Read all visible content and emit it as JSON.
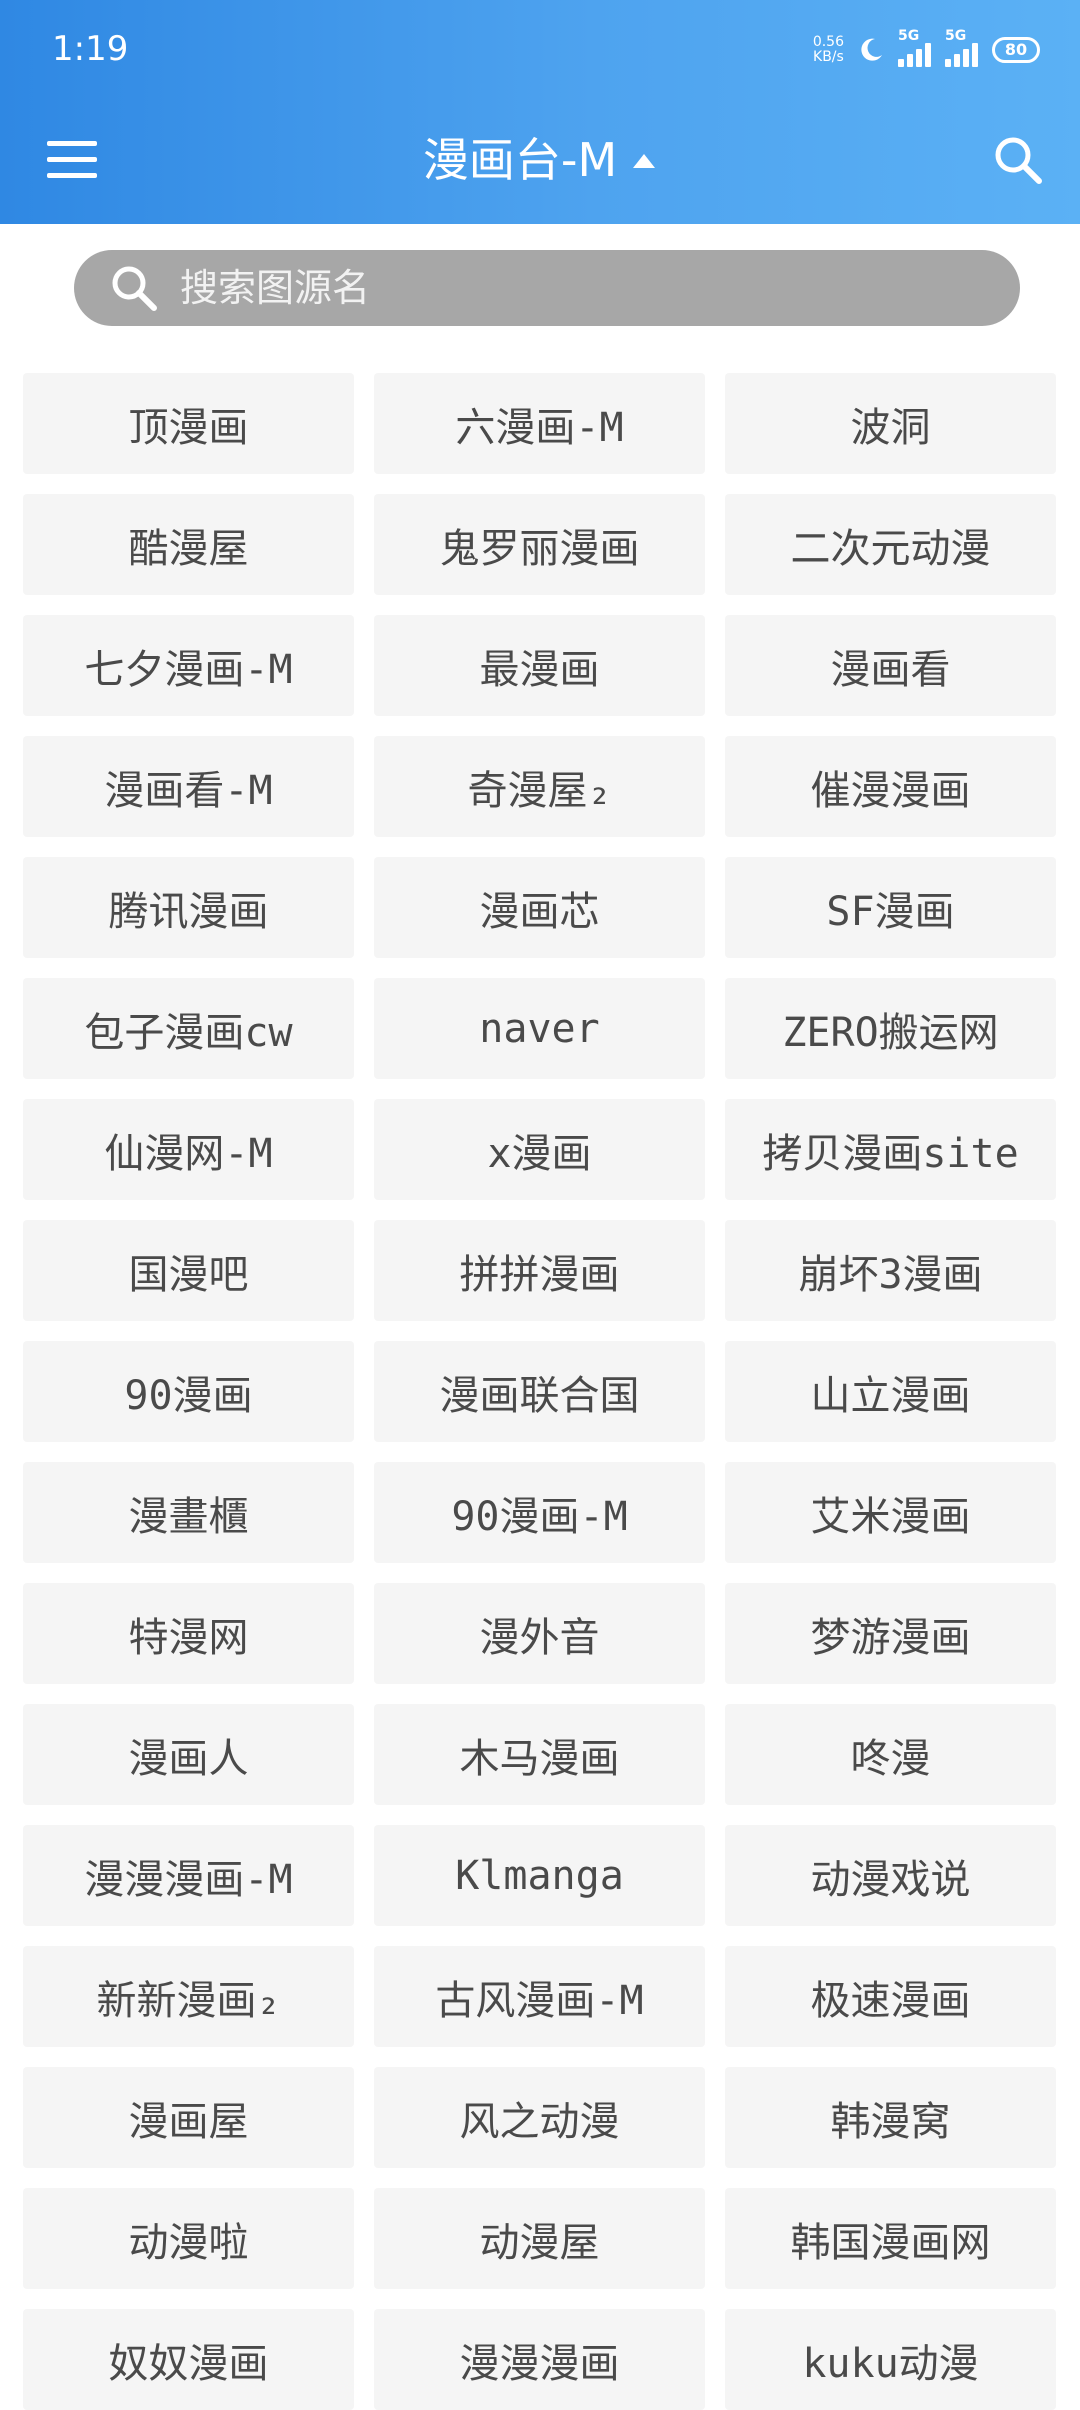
{
  "status_bar": {
    "time": "1:19",
    "net_speed_value": "0.56",
    "net_speed_unit": "KB/s",
    "signal_1_tag": "5G",
    "signal_2_tag": "5G",
    "battery": "80"
  },
  "toolbar": {
    "title": "漫画台-M"
  },
  "search": {
    "placeholder": "搜索图源名"
  },
  "sources": [
    "顶漫画",
    "六漫画-M",
    "波洞",
    "酷漫屋",
    "鬼罗丽漫画",
    "二次元动漫",
    "七夕漫画-M",
    "最漫画",
    "漫画看",
    "漫画看-M",
    "奇漫屋₂",
    "催漫漫画",
    "腾讯漫画",
    "漫画芯",
    "SF漫画",
    "包子漫画cw",
    "naver",
    "ZERO搬运网",
    "仙漫网-M",
    "x漫画",
    "拷贝漫画site",
    "国漫吧",
    "拼拼漫画",
    "崩坏3漫画",
    "90漫画",
    "漫画联合国",
    "山立漫画",
    "漫畫櫃",
    "90漫画-M",
    "艾米漫画",
    "特漫网",
    "漫外音",
    "梦游漫画",
    "漫画人",
    "木马漫画",
    "咚漫",
    "漫漫漫画-M",
    "Klmanga",
    "动漫戏说",
    "新新漫画₂",
    "古风漫画-M",
    "极速漫画",
    "漫画屋",
    "风之动漫",
    "韩漫窝",
    "动漫啦",
    "动漫屋",
    "韩国漫画网",
    "奴奴漫画",
    "漫漫漫画",
    "kuku动漫"
  ],
  "colors": {
    "appbar_start": "#2f88e3",
    "appbar_end": "#5bb1f5",
    "tile_bg": "#f5f5f5",
    "tile_text": "#4a4a4a",
    "search_bg": "#a7a7a7"
  },
  "icons": {
    "menu": "menu-icon",
    "title_caret": "caret-up-icon",
    "search": "search-icon",
    "moon": "moon-icon"
  }
}
